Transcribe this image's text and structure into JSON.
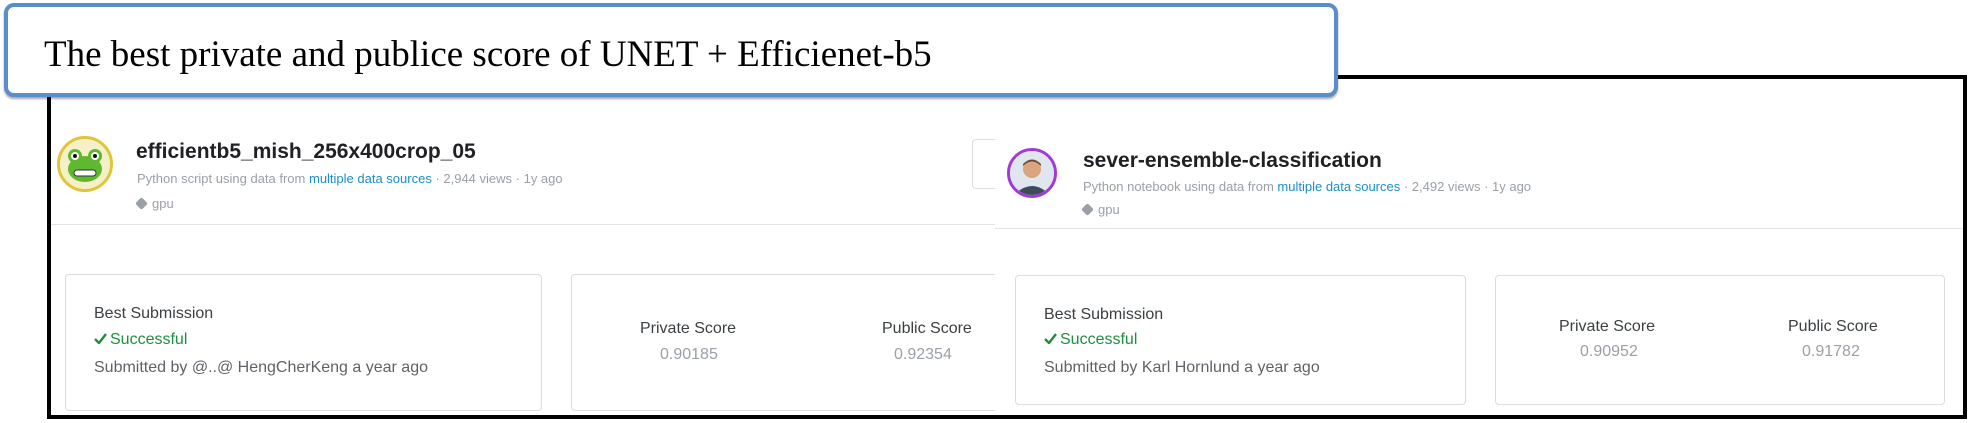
{
  "caption": "The best private and publice score of UNET + Efficienet-b5",
  "left": {
    "title": "efficientb5_mish_256x400crop_05",
    "meta_prefix": "Python script using data from ",
    "meta_link": "multiple data sources",
    "meta_suffix": " · 2,944 views · 1y ago",
    "tag": "gpu",
    "best_label": "Best Submission",
    "status": "Successful",
    "submitted": "Submitted by @..@ HengCherKeng a year ago",
    "private_label": "Private Score",
    "private_value": "0.90185",
    "public_label": "Public Score",
    "public_value": "0.92354",
    "avatar_icon": "frog-avatar-icon"
  },
  "right": {
    "title": "sever-ensemble-classification",
    "meta_prefix": "Python notebook using data from ",
    "meta_link": "multiple data sources",
    "meta_suffix": " · 2,492 views · 1y ago",
    "tag": "gpu",
    "best_label": "Best Submission",
    "status": "Successful",
    "submitted": "Submitted by Karl Hornlund a year ago",
    "private_label": "Private Score",
    "private_value": "0.90952",
    "public_label": "Public Score",
    "public_value": "0.91782",
    "avatar_icon": "user-photo-avatar-icon"
  },
  "colors": {
    "caption_border": "#5b8dc9",
    "link": "#1a8fc9",
    "success": "#1e8e3e",
    "left_avatar_ring": "#e0c53a",
    "right_avatar_ring": "#a23bd6"
  },
  "icons": {
    "status": "check-icon",
    "tag": "tag-icon"
  }
}
